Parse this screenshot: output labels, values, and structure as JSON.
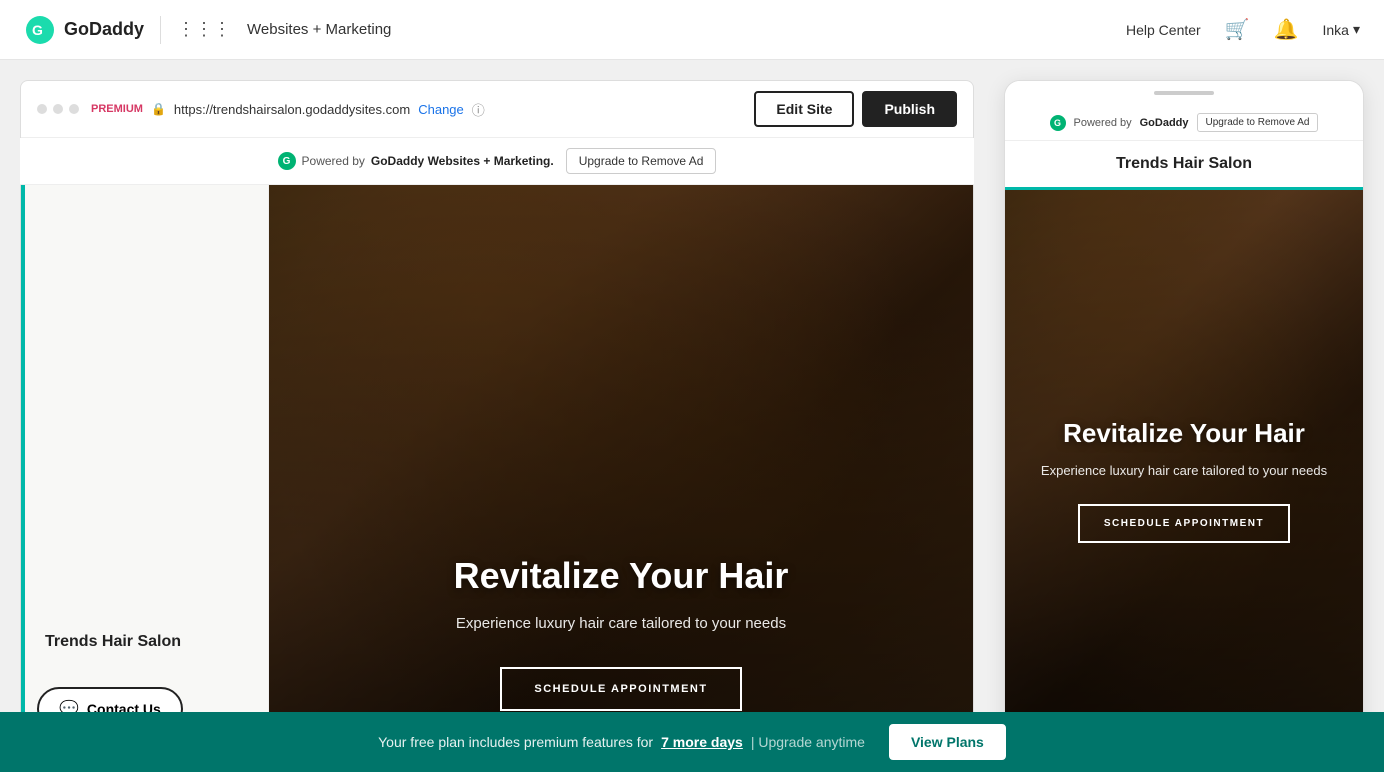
{
  "nav": {
    "logo_text": "GoDaddy",
    "product_name": "Websites + Marketing",
    "help_center": "Help Center",
    "user_name": "Inka"
  },
  "toolbar": {
    "edit_site_label": "Edit Site",
    "publish_label": "Publish"
  },
  "browser": {
    "premium_label": "PREMIUM",
    "url": "https://trendshairsalon.godaddysites.com",
    "change_label": "Change",
    "ad_text": "Powered by ",
    "ad_brand": "GoDaddy Websites + Marketing.",
    "upgrade_ad_label": "Upgrade to Remove Ad"
  },
  "mobile_browser": {
    "powered_by": "Powered by ",
    "godaddy_label": "GoDaddy",
    "upgrade_ad_label": "Upgrade to Remove Ad"
  },
  "site": {
    "name": "Trends Hair Salon",
    "hero_title": "Revitalize Your Hair",
    "hero_subtitle": "Experience luxury hair care tailored to your needs",
    "schedule_btn": "SCHEDULE APPOINTMENT",
    "contact_us": "Contact Us"
  },
  "mobile_site": {
    "title": "Trends Hair Salon",
    "hero_title": "Revitalize Your Hair",
    "hero_subtitle": "Experience luxury hair care tailored to your needs",
    "schedule_btn": "SCHEDULE APPOINTMENT"
  },
  "bottom_bar": {
    "text": "Your free plan includes premium features for",
    "link_text": "7 more days",
    "separator": "| Upgrade anytime",
    "view_plans_label": "View Plans"
  }
}
